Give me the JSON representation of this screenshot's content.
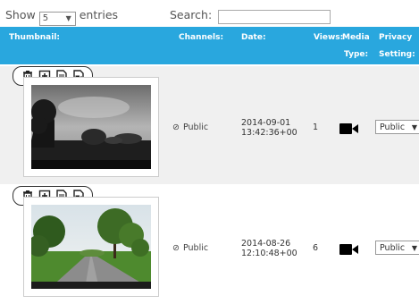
{
  "length_menu": {
    "prefix": "Show",
    "value": "5",
    "suffix": "entries"
  },
  "search": {
    "label": "Search:",
    "value": ""
  },
  "columns": {
    "thumbnail": "Thumbnail:",
    "channels": "Channels:",
    "date": "Date:",
    "views": "Views:",
    "media_type_1": "Media",
    "media_type_2": "Type:",
    "privacy_1": "Privacy",
    "privacy_2": "Setting:"
  },
  "rows": [
    {
      "channel": "Public",
      "date_line1": "2014-09-01",
      "date_line2": "13:42:36+00",
      "views": "1",
      "media_type_icon": "video-camera-icon",
      "privacy": "Public"
    },
    {
      "channel": "Public",
      "date_line1": "2014-08-26",
      "date_line2": "12:10:48+00",
      "views": "6",
      "media_type_icon": "video-camera-icon",
      "privacy": "Public"
    }
  ],
  "toolbar_icons": [
    "trash-icon",
    "add-icon",
    "document-icon",
    "file-video-icon"
  ],
  "colors": {
    "header_bg": "#29a7de",
    "row_alt_bg": "#f0f0f0"
  }
}
